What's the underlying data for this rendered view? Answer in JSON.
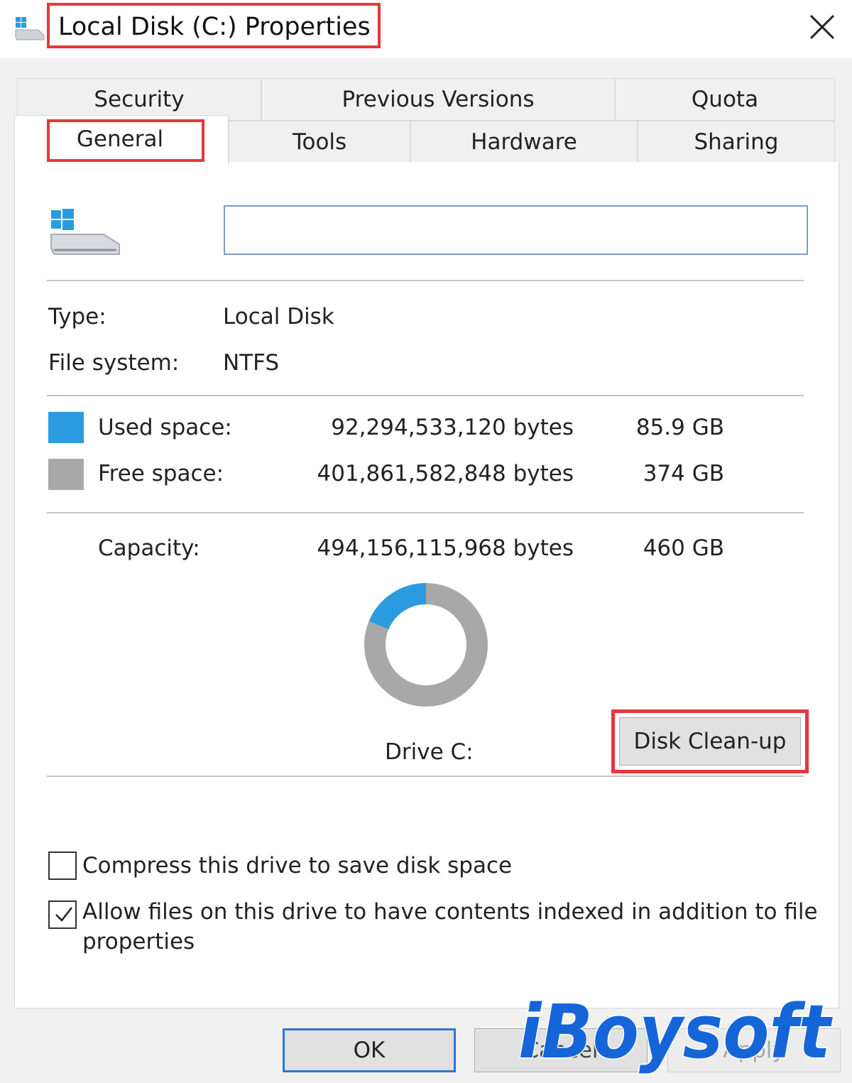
{
  "window": {
    "title": "Local Disk (C:) Properties",
    "close_glyph": "✕"
  },
  "tabs": {
    "row1": [
      "Security",
      "Previous Versions",
      "Quota"
    ],
    "row2": [
      "General",
      "Tools",
      "Hardware",
      "Sharing"
    ],
    "active": "General"
  },
  "general": {
    "drive_name_value": "",
    "type_label": "Type:",
    "type_value": "Local Disk",
    "fs_label": "File system:",
    "fs_value": "NTFS",
    "used_label": "Used space:",
    "used_bytes": "92,294,533,120 bytes",
    "used_size": "85.9 GB",
    "free_label": "Free space:",
    "free_bytes": "401,861,582,848 bytes",
    "free_size": "374 GB",
    "capacity_label": "Capacity:",
    "capacity_bytes": "494,156,115,968 bytes",
    "capacity_size": "460 GB",
    "used_fraction": 0.187,
    "drive_label": "Drive C:",
    "cleanup_button": "Disk Clean-up",
    "compress_label": "Compress this drive to save disk space",
    "compress_checked": false,
    "index_label_line1": "Allow files on this drive to have contents indexed in addition to file",
    "index_label_line2": "properties",
    "index_checked": true
  },
  "footer": {
    "ok": "OK",
    "cancel": "Cancel",
    "apply": "Apply"
  },
  "watermark": "iBoysoft",
  "colors": {
    "used": "#2b9be0",
    "free": "#a8a8a8",
    "highlight": "#e5373c",
    "watermark": "#1565d8"
  },
  "icons": {
    "app": "drive-icon",
    "drive": "windows-drive-icon",
    "close": "close-icon"
  }
}
